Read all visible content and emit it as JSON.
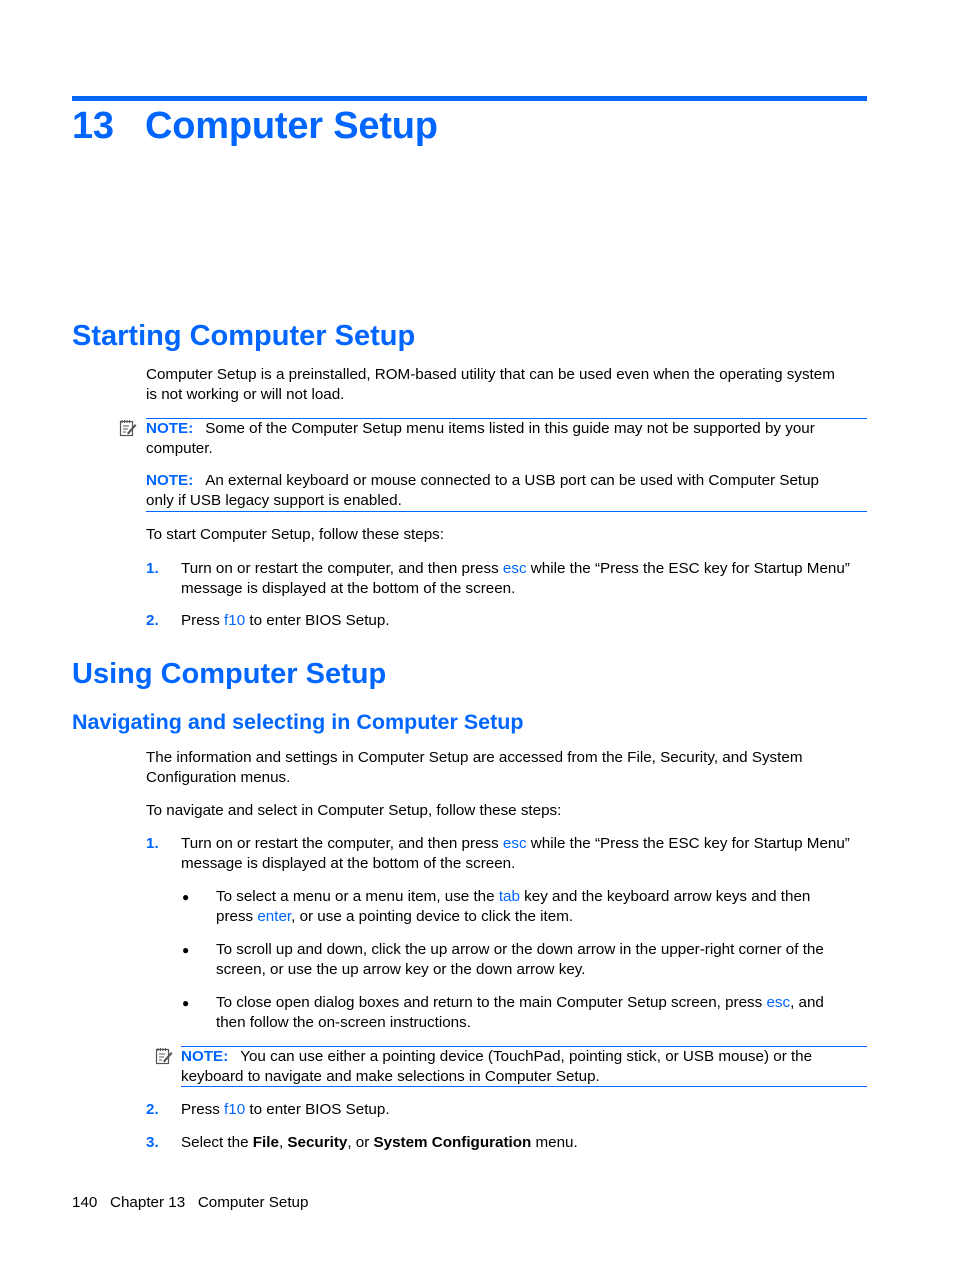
{
  "chapter": {
    "number": "13",
    "title": "Computer Setup"
  },
  "colors": {
    "accent": "#0066ff",
    "text": "#000000"
  },
  "sections": {
    "starting": {
      "heading": "Starting Computer Setup",
      "intro_line1": "Computer Setup is a preinstalled, ROM-based utility that can be used even when the operating system",
      "intro_line2": "is not working or will not load.",
      "notes": [
        {
          "icon": "note-pencil-icon",
          "label": "NOTE:",
          "line1": "Some of the Computer Setup menu items listed in this guide may not be supported by your",
          "line2": "computer."
        },
        {
          "label": "NOTE:",
          "line1": "An external keyboard or mouse connected to a USB port can be used with Computer Setup",
          "line2": "only if USB legacy support is enabled."
        }
      ],
      "steps_intro": "To start Computer Setup, follow these steps:",
      "steps": [
        {
          "number": "1.",
          "pre": "Turn on or restart the computer, and then press ",
          "key": "esc",
          "post": " while the “Press the ESC key for Startup Menu”",
          "line2": "message is displayed at the bottom of the screen."
        },
        {
          "number": "2.",
          "pre": "Press ",
          "key": "f10",
          "post": " to enter BIOS Setup."
        }
      ]
    },
    "using": {
      "heading": "Using Computer Setup",
      "subheading": "Navigating and selecting in Computer Setup",
      "intro_line1": "The information and settings in Computer Setup are accessed from the File, Security, and System",
      "intro_line2": "Configuration menus.",
      "steps_intro": "To navigate and select in Computer Setup, follow these steps:",
      "step1": {
        "number": "1.",
        "pre": "Turn on or restart the computer, and then press ",
        "key": "esc",
        "post": " while the “Press the ESC key for Startup Menu”",
        "line2": "message is displayed at the bottom of the screen."
      },
      "bullets": [
        {
          "glyph": "●",
          "pre": "To select a menu or a menu item, use the ",
          "key": "tab",
          "post": " key and the keyboard arrow keys and then",
          "line2_pre": "press ",
          "line2_key": "enter",
          "line2_post": ", or use a pointing device to click the item."
        },
        {
          "glyph": "●",
          "line1": "To scroll up and down, click the up arrow or the down arrow in the upper-right corner of the",
          "line2": "screen, or use the up arrow key or the down arrow key."
        },
        {
          "glyph": "●",
          "pre": "To close open dialog boxes and return to the main Computer Setup screen, press ",
          "key": "esc",
          "post": ", and",
          "line2": "then follow the on-screen instructions."
        }
      ],
      "note": {
        "icon": "note-pencil-icon",
        "label": "NOTE:",
        "line1": "You can use either a pointing device (TouchPad, pointing stick, or USB mouse) or the",
        "line2": "keyboard to navigate and make selections in Computer Setup."
      },
      "step2": {
        "number": "2.",
        "pre": "Press ",
        "key": "f10",
        "post": " to enter BIOS Setup."
      },
      "step3": {
        "number": "3.",
        "pre": "Select the ",
        "bold1": "File",
        "sep1": ", ",
        "bold2": "Security",
        "sep2": ", or ",
        "bold3": "System Configuration",
        "post": " menu."
      }
    }
  },
  "footer": {
    "page_number": "140",
    "chapter_label": "Chapter 13",
    "chapter_title": "Computer Setup"
  }
}
